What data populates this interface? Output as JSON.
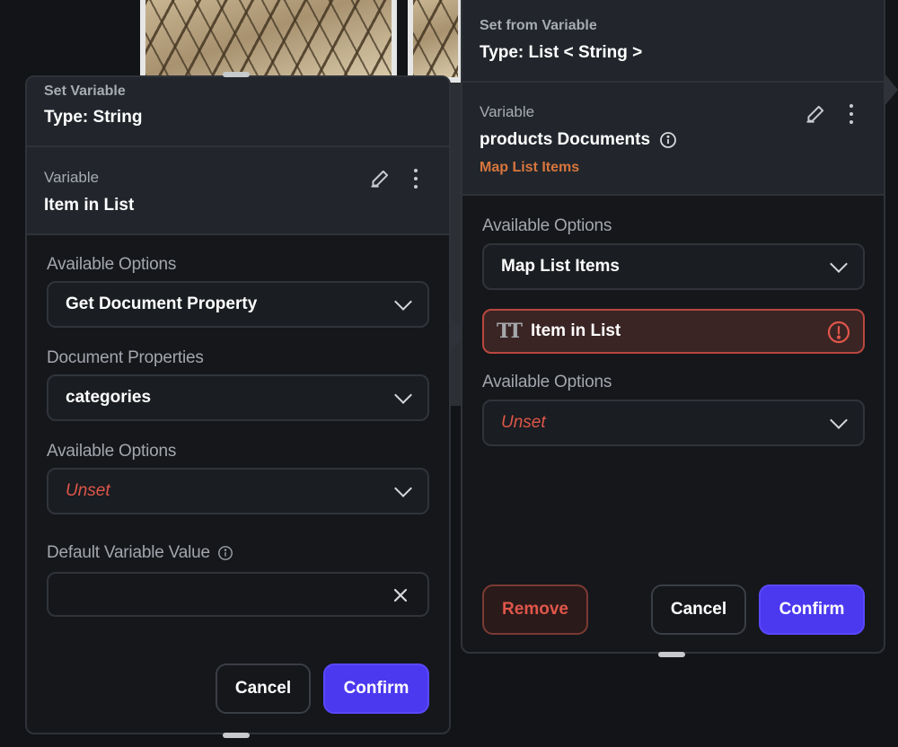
{
  "left_panel": {
    "header_small": "Set Variable",
    "header_type": "Type: String",
    "variable_label": "Variable",
    "variable_name": "Item in List",
    "options_label_1": "Available Options",
    "options_value_1": "Get Document Property",
    "doc_props_label": "Document Properties",
    "doc_props_value": "categories",
    "options_label_2": "Available Options",
    "options_value_2": "Unset",
    "default_label": "Default Variable Value",
    "default_value": "",
    "cancel": "Cancel",
    "confirm": "Confirm"
  },
  "right_panel": {
    "header_small": "Set from Variable",
    "header_type": "Type: List < String >",
    "variable_label": "Variable",
    "variable_name": "products Documents",
    "map_link": "Map List Items",
    "options_label_1": "Available Options",
    "options_value_1": "Map List Items",
    "item_chip": "Item in List",
    "options_label_2": "Available Options",
    "options_value_2": "Unset",
    "remove": "Remove",
    "cancel": "Cancel",
    "confirm": "Confirm"
  },
  "colors": {
    "accent": "#4b39ef",
    "error": "#e0564a",
    "map_link": "#d9763d",
    "panel_bg": "#15171b",
    "panel_header": "#22262c"
  }
}
